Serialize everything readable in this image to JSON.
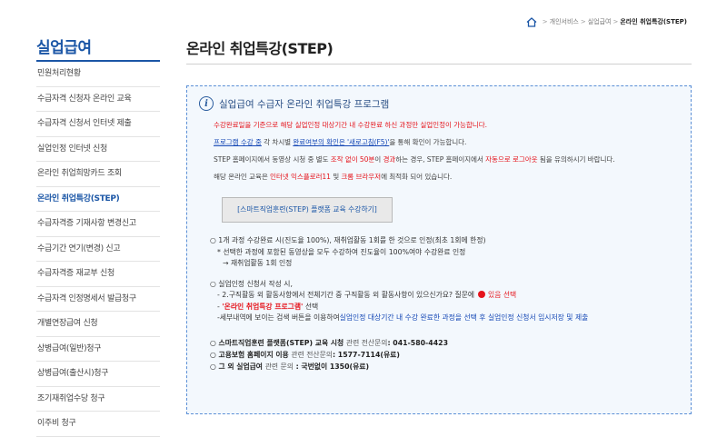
{
  "breadcrumb": {
    "items": [
      "개인서비스",
      "실업급여",
      "온라인 취업특강(STEP)"
    ],
    "separator": ">"
  },
  "sidebar": {
    "title": "실업급여",
    "items": [
      {
        "label": "민원처리현황"
      },
      {
        "label": "수급자격 신청자 온라인 교육"
      },
      {
        "label": "수급자격 신청서 인터넷 제출"
      },
      {
        "label": "실업인정 인터넷 신청"
      },
      {
        "label": "온라인 취업희망카드 조회"
      },
      {
        "label": "온라인 취업특강(STEP)",
        "active": true
      },
      {
        "label": "수급자격증 기재사항 변경신고"
      },
      {
        "label": "수급기간 연기(변경) 신고"
      },
      {
        "label": "수급자격증 재교부 신청"
      },
      {
        "label": "수급자격 인정명세서 발급청구"
      },
      {
        "label": "개별연장급여 신청"
      },
      {
        "label": "상병급여(일반)청구"
      },
      {
        "label": "상병급여(출산시)청구"
      },
      {
        "label": "조기재취업수당 청구"
      },
      {
        "label": "이주비 청구"
      }
    ]
  },
  "main": {
    "title": "온라인 취업특강(STEP)",
    "box": {
      "icon": "info-circle-icon",
      "title": "실업급여 수급자 온라인 취업특강 프로그램",
      "p1": "수강완료일을 기준으로 해당 실업인정 대상기간 내 수강완료 하신 과정만 실업인정이 가능합니다.",
      "p2": {
        "a": "프로그램 수강 중",
        "b": " 각 차시별 ",
        "c": "완료여부의 확인은 '새로고침(F5)'",
        "d": "을 통해 확인이 가능합니다."
      },
      "p3": {
        "a": "STEP 홈페이지에서 동영상 시청 중 별도 ",
        "b": "조작 없이 50분",
        "c": "이 ",
        "d": "경과",
        "e": "하는 경우, STEP 홈페이지에서 ",
        "f": "자동으로 로그아웃",
        "g": " 됨을 유의하시기 바랍니다."
      },
      "p4": {
        "a": "해당 온라인 교육은 ",
        "b": "인터넷 익스플로러11",
        "c": " 및 ",
        "d": "크롬 브라우저",
        "e": "에 최적화 되어 있습니다."
      },
      "button_label": "[스마트직업훈련(STEP) 플랫폼 교육 수강하기]",
      "list1": {
        "line1": "○ 1개 과정 수강완료 시(진도율 100%), 재취업활동 1회를 한 것으로 인정(최초 1회에 한정)",
        "line2": "* 선택한 과정에 포함된 동영상을 모두 수강하여 진도율이 100%여야 수강완료 인정",
        "line3": "→ 재취업활동 1회 인정"
      },
      "list2": {
        "line1": "○ 실업인정 신청서 작성 시,",
        "line2a": "- 2.구직활동 외 활동사항에서 전체기간 중 구직활동 외 활동사항이 있으신가요? 질문에 ",
        "line2b": " 있음 선택",
        "line3a": "- ",
        "line3b": "'온라인 취업특강 프로그램'",
        "line3c": " 선택",
        "line4a": "-세부내역에 보이는 검색 버튼을 이용하여",
        "line4b": "실업인정 대상기간 내 수강 완료한 과정을 선택 후 실업인정 신청서 임시저장 및 제출"
      },
      "contacts": [
        {
          "a": "○ 스마트직업훈련 플랫폼(STEP) 교육 시청 ",
          "b": "관련 전산문의",
          "c": ": 041-580-4423"
        },
        {
          "a": "○ 고용보험 홈페이지 이용 ",
          "b": "관련 전산문의",
          "c": ": 1577-7114(유료)"
        },
        {
          "a": "○ 그 외 실업급여 ",
          "b": "관련 문의",
          "c": " : 국번없이 1350(유료)"
        }
      ]
    }
  },
  "colors": {
    "accent": "#1b56a6",
    "red": "#e5141c",
    "box_bg": "#f3f8fd",
    "box_border": "#5b8fd6"
  }
}
